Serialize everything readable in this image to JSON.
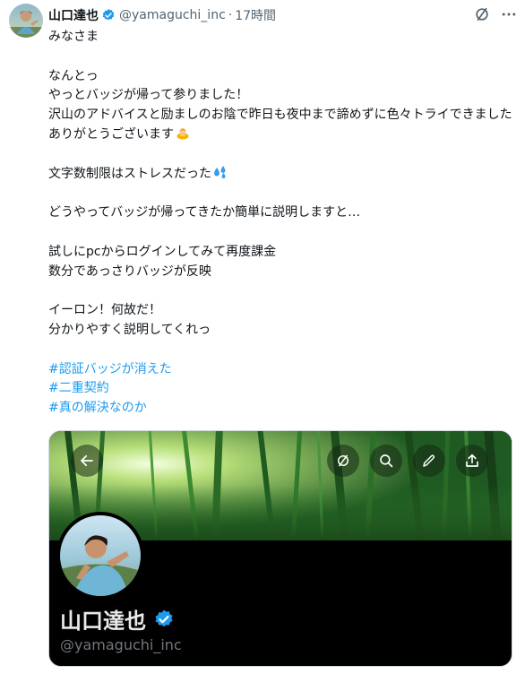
{
  "tweet": {
    "author": {
      "display_name": "山口達也",
      "handle": "@yamaguchi_inc",
      "separator": "·",
      "time": "17時間"
    },
    "lines": {
      "l1": "みなさま",
      "l2": "なんとっ",
      "l3": "やっとバッジが帰って参りました！",
      "l4": "沢山のアドバイスと励ましのお陰で昨日も夜中まで諦めずに色々トライできました",
      "l5": "ありがとうございます",
      "l6": "文字数制限はストレスだった",
      "l7": "どうやってバッジが帰ってきたか簡単に説明しますと…",
      "l8": "試しにpcからログインしてみて再度課金",
      "l9": "数分であっさりバッジが反映",
      "l10": "イーロン！何故だ！",
      "l11": "分かりやすく説明してくれっ"
    },
    "hashtags": [
      "#認証バッジが消えた",
      "#二重契約",
      "#真の解決なのか"
    ],
    "emojis": {
      "after_thanks": "bowing-person-emoji",
      "after_stress": "sweat-droplets-emoji"
    },
    "icons": {
      "verified": "verified-badge-icon",
      "top": "circle-slash-icon",
      "more": "more-icon"
    },
    "colors": {
      "link": "#1d9bf0",
      "verified": "#1d9bf0",
      "secondary_text": "#536471"
    }
  },
  "media": {
    "profile_name": "山口達也",
    "profile_handle": "@yamaguchi_inc",
    "buttons": [
      "back-arrow-icon",
      "circle-slash-icon",
      "search-icon",
      "pencil-icon",
      "share-icon"
    ]
  }
}
